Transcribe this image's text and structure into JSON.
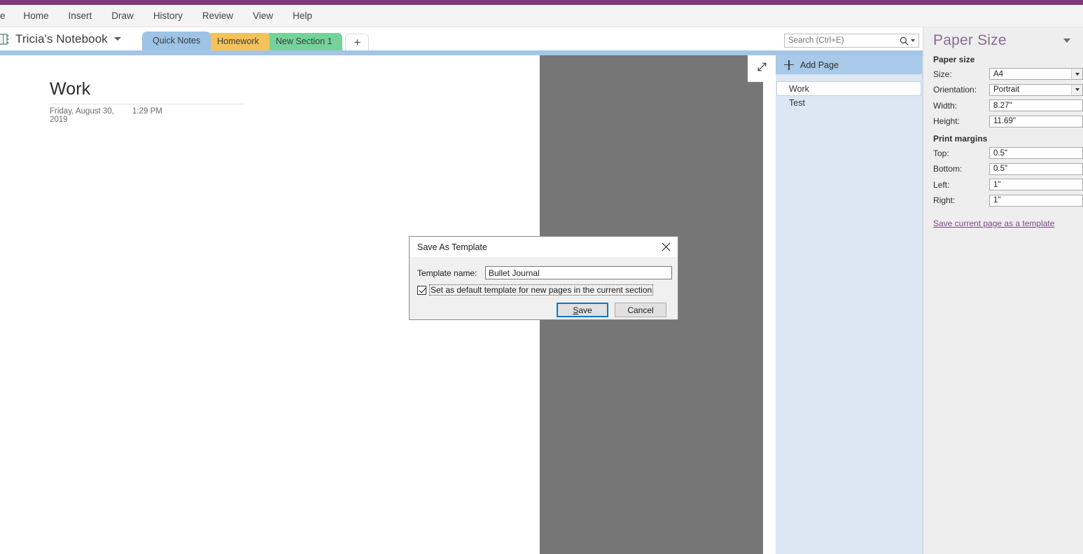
{
  "theme": {
    "accent_purple": "#80397b",
    "tab_selected_blue": "#9dc3e6",
    "tab_homework_amber": "#f3c359",
    "tab_newsection_green": "#74d39a",
    "panel_blue": "#dce7f3",
    "add_page_blue": "#a8c9e8",
    "gray_area": "#767676",
    "taskpane_bg": "#eeeeee",
    "taskpane_title": "#8a6a94",
    "link_purple": "#7c4a85",
    "focus_blue": "#0078d7"
  },
  "menubar": {
    "items": [
      {
        "label": "ile",
        "name": "menu-file"
      },
      {
        "label": "Home",
        "name": "menu-home"
      },
      {
        "label": "Insert",
        "name": "menu-insert"
      },
      {
        "label": "Draw",
        "name": "menu-draw"
      },
      {
        "label": "History",
        "name": "menu-history"
      },
      {
        "label": "Review",
        "name": "menu-review"
      },
      {
        "label": "View",
        "name": "menu-view"
      },
      {
        "label": "Help",
        "name": "menu-help"
      }
    ]
  },
  "notebook": {
    "title": "Tricia's Notebook",
    "icon": "notebook-icon",
    "caret_icon": "chevron-down-icon"
  },
  "tabs": [
    {
      "label": "Quick Notes",
      "color": "#9dc3e6",
      "selected": true
    },
    {
      "label": "Homework",
      "color": "#f3c359",
      "selected": false
    },
    {
      "label": "New Section 1",
      "color": "#74d39a",
      "selected": false
    }
  ],
  "add_section": {
    "label": "+",
    "icon": "plus-icon"
  },
  "search": {
    "placeholder": "Search (Ctrl+E)",
    "value": "",
    "icon": "search-icon",
    "dropdown_icon": "chevron-down-icon"
  },
  "page": {
    "title": "Work",
    "date": "Friday, August 30, 2019",
    "time": "1:29 PM"
  },
  "expand_button": {
    "icon": "expand-diagonal-icon"
  },
  "page_panel": {
    "add_page_label": "Add Page",
    "add_page_icon": "plus-icon",
    "pages": [
      {
        "label": "Work",
        "selected": true
      },
      {
        "label": "Test",
        "selected": false
      }
    ]
  },
  "taskpane": {
    "title": "Paper Size",
    "collapse_icon": "chevron-down-icon",
    "sections": [
      {
        "label": "Paper size",
        "fields": [
          {
            "label": "Size:",
            "value": "A4",
            "type": "select",
            "name": "paper-size-select"
          },
          {
            "label": "Orientation:",
            "value": "Portrait",
            "type": "select",
            "name": "orientation-select"
          },
          {
            "label": "Width:",
            "value": "8.27\"",
            "type": "text",
            "name": "width-field"
          },
          {
            "label": "Height:",
            "value": "11.69\"",
            "type": "text",
            "name": "height-field"
          }
        ]
      },
      {
        "label": "Print margins",
        "fields": [
          {
            "label": "Top:",
            "value": "0.5\"",
            "type": "text",
            "name": "margin-top-field"
          },
          {
            "label": "Bottom:",
            "value": "0.5\"",
            "type": "text",
            "name": "margin-bottom-field"
          },
          {
            "label": "Left:",
            "value": "1\"",
            "type": "text",
            "name": "margin-left-field"
          },
          {
            "label": "Right:",
            "value": "1\"",
            "type": "text",
            "name": "margin-right-field"
          }
        ]
      }
    ],
    "link_label": "Save current page as a template"
  },
  "dialog": {
    "title": "Save As Template",
    "close_icon": "close-icon",
    "name_label": "Template name:",
    "name_value": "Bullet Journal",
    "name_placeholder": "",
    "checkbox_label": "Set as default template for new pages in the current section",
    "checkbox_checked": true,
    "save_label": "Save",
    "save_accesskey": "S",
    "cancel_label": "Cancel"
  }
}
